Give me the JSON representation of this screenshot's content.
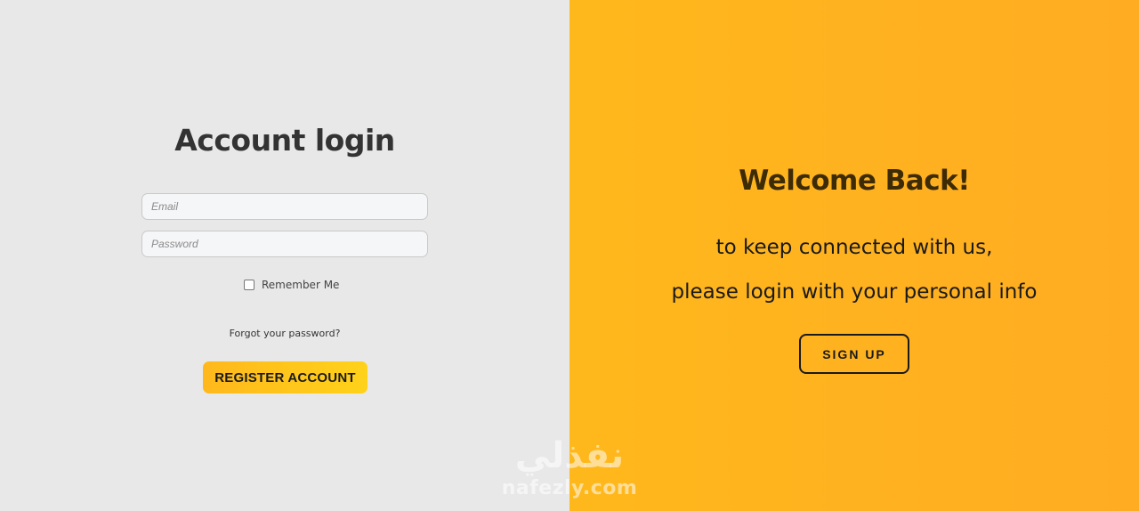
{
  "login": {
    "title": "Account login",
    "email_placeholder": "Email",
    "password_placeholder": "Password",
    "remember_label": "Remember Me",
    "remember_checked": false,
    "forgot_label": "Forgot your password?",
    "register_label": "REGISTER ACCOUNT"
  },
  "welcome": {
    "title": "Welcome Back!",
    "line1": "to keep connected with us,",
    "line2": "please login with your personal info",
    "signup_label": "SIGN UP"
  },
  "watermark": {
    "logo": "نفذلي",
    "url": "nafezly.com"
  },
  "colors": {
    "accent": "#ffb81c",
    "left_background": "#e8e8e8",
    "title_text": "#333333"
  }
}
